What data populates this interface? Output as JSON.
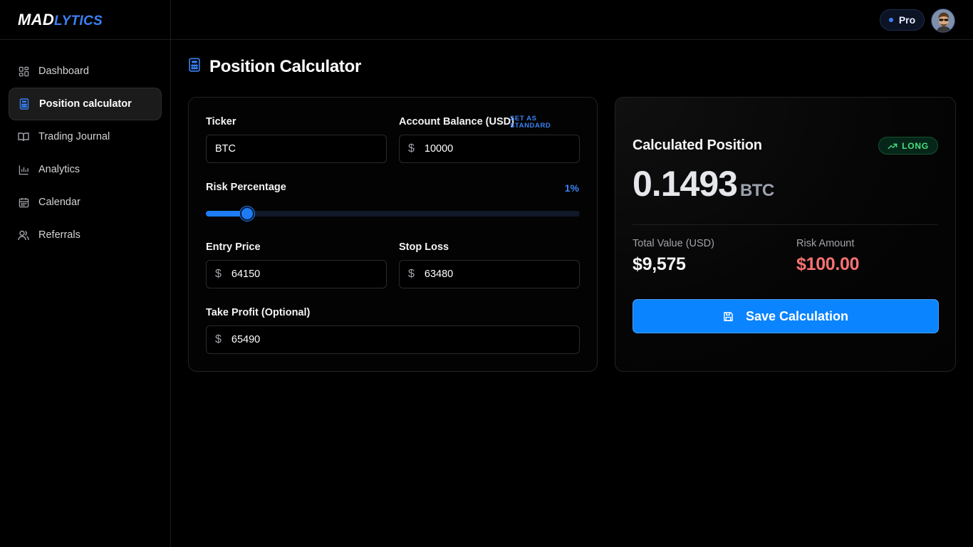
{
  "brand": {
    "part1": "MAD",
    "part2": "LYTICS"
  },
  "sidebar": {
    "items": [
      {
        "label": "Dashboard",
        "icon": "grid-icon"
      },
      {
        "label": "Position calculator",
        "icon": "calculator-icon",
        "active": true
      },
      {
        "label": "Trading Journal",
        "icon": "book-icon"
      },
      {
        "label": "Analytics",
        "icon": "bar-chart-icon"
      },
      {
        "label": "Calendar",
        "icon": "calendar-icon"
      },
      {
        "label": "Referrals",
        "icon": "users-icon"
      }
    ]
  },
  "header": {
    "plan_label": "Pro"
  },
  "page": {
    "title": "Position Calculator"
  },
  "form": {
    "ticker": {
      "label": "Ticker",
      "value": "BTC"
    },
    "account_balance": {
      "label": "Account Balance (USD)",
      "set_standard": "SET AS STANDARD",
      "currency": "$",
      "value": "10000"
    },
    "risk": {
      "label": "Risk Percentage",
      "value_label": "1%",
      "fraction": 0.11
    },
    "entry_price": {
      "label": "Entry Price",
      "currency": "$",
      "value": "64150"
    },
    "stop_loss": {
      "label": "Stop Loss",
      "currency": "$",
      "value": "63480"
    },
    "take_profit": {
      "label": "Take Profit (Optional)",
      "currency": "$",
      "value": "65490"
    }
  },
  "result": {
    "title": "Calculated Position",
    "direction": "LONG",
    "size": "0.1493",
    "unit": "BTC",
    "total_value_label": "Total Value (USD)",
    "total_value": "$9,575",
    "risk_amount_label": "Risk Amount",
    "risk_amount": "$100.00",
    "save_label": "Save Calculation"
  },
  "colors": {
    "accent": "#0a84ff",
    "positive": "#4ade80",
    "negative": "#f87171"
  }
}
